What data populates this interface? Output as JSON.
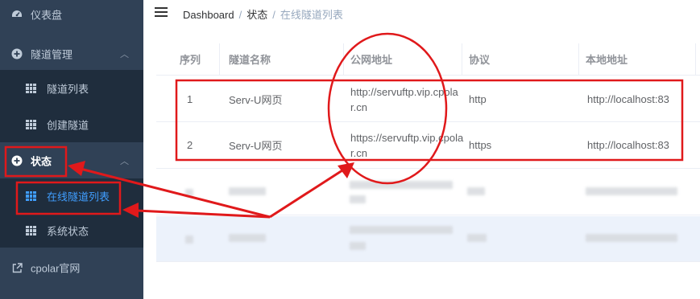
{
  "sidebar": {
    "dashboard": "仪表盘",
    "tunnel_manage": "隧道管理",
    "tunnel_list": "隧道列表",
    "create_tunnel": "创建隧道",
    "status": "状态",
    "online_tunnel_list": "在线隧道列表",
    "system_status": "系统状态",
    "cpolar_site": "cpolar官网"
  },
  "breadcrumb": {
    "home": "Dashboard",
    "status": "状态",
    "current": "在线隧道列表",
    "sep": "/"
  },
  "table": {
    "columns": [
      "序列",
      "隧道名称",
      "公网地址",
      "协议",
      "本地地址"
    ],
    "rows": [
      {
        "index": "1",
        "name": "Serv-U网页",
        "public_line1": "http://servuftp.vip.cpola",
        "public_line2": "r.cn",
        "protocol": "http",
        "local": "http://localhost:83"
      },
      {
        "index": "2",
        "name": "Serv-U网页",
        "public_line1": "https://servuftp.vip.cpola",
        "public_line2": "r.cn",
        "protocol": "https",
        "local": "http://localhost:83"
      }
    ]
  },
  "colors": {
    "sidebar_bg": "#304156",
    "submenu_bg": "#1f2d3d",
    "active": "#409eff",
    "annotation": "#e0191b"
  }
}
